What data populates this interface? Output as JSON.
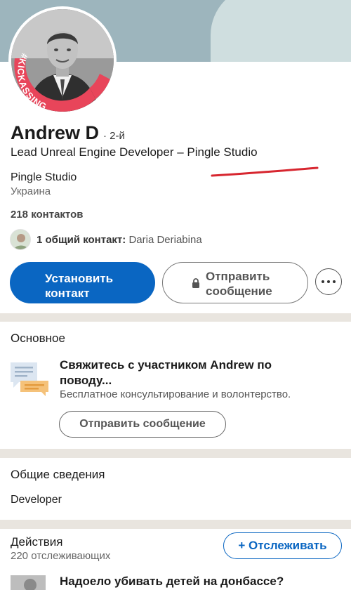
{
  "profile": {
    "name": "Andrew D",
    "degree": "· 2-й",
    "headline": "Lead Unreal Engine Developer – Pingle Studio",
    "company": "Pingle Studio",
    "location": "Украина",
    "contacts": "218 контактов",
    "mutual_label": "1 общий контакт:",
    "mutual_name": " Daria Deriabina",
    "avatar_badge": "#KICKASSING"
  },
  "actions": {
    "connect_label_1": "Установить",
    "connect_label_2": "контакт",
    "message_label_1": "Отправить",
    "message_label_2": "сообщение"
  },
  "basic": {
    "title": "Основное",
    "heading": "Свяжитесь с участником Andrew по поводу...",
    "subtitle": "Бесплатное консультирование и волонтерство.",
    "button": "Отправить сообщение"
  },
  "about": {
    "title": "Общие сведения",
    "value": "Developer"
  },
  "activity": {
    "title": "Действия",
    "followers": "220 отслеживающих",
    "follow_button": "+ Отслеживать",
    "post_title": "Надоело убивать детей на донбассе?"
  },
  "colors": {
    "accent": "#0a66c2",
    "annotation": "#d7262f",
    "badge": "#e8455a"
  }
}
